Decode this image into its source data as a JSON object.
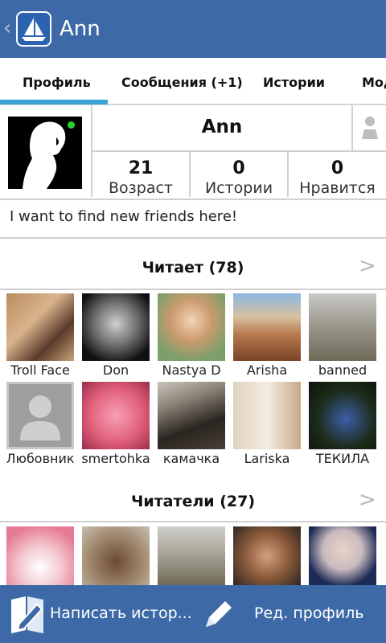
{
  "header": {
    "back": "‹",
    "title": "Ann",
    "logo_icon": "sailboat-logo-icon"
  },
  "tabs": [
    {
      "label": "Профиль",
      "active": true
    },
    {
      "label": "Сообщения (+1)"
    },
    {
      "label": "Истории"
    },
    {
      "label": "Мод"
    }
  ],
  "profile": {
    "name": "Ann",
    "online": true,
    "stats": [
      {
        "value": "21",
        "label": "Возраст"
      },
      {
        "value": "0",
        "label": "Истории"
      },
      {
        "value": "0",
        "label": "Нравится"
      }
    ],
    "status": "I want to find new friends here!"
  },
  "following": {
    "title": "Читает (78)",
    "users": [
      "Troll Face",
      "Don",
      "Nastya D",
      "Arisha",
      "banned",
      "Любовник",
      "smertohka",
      "камачка",
      "Lariska",
      "ТЕКИЛА"
    ]
  },
  "followers": {
    "title": "Читатели (27)"
  },
  "bottom": {
    "write_label": "Написать истор...",
    "edit_label": "Ред. профиль"
  },
  "colors": {
    "brand": "#3d6aa6",
    "tab_accent": "#3aa3d4",
    "online": "#27d12c"
  }
}
